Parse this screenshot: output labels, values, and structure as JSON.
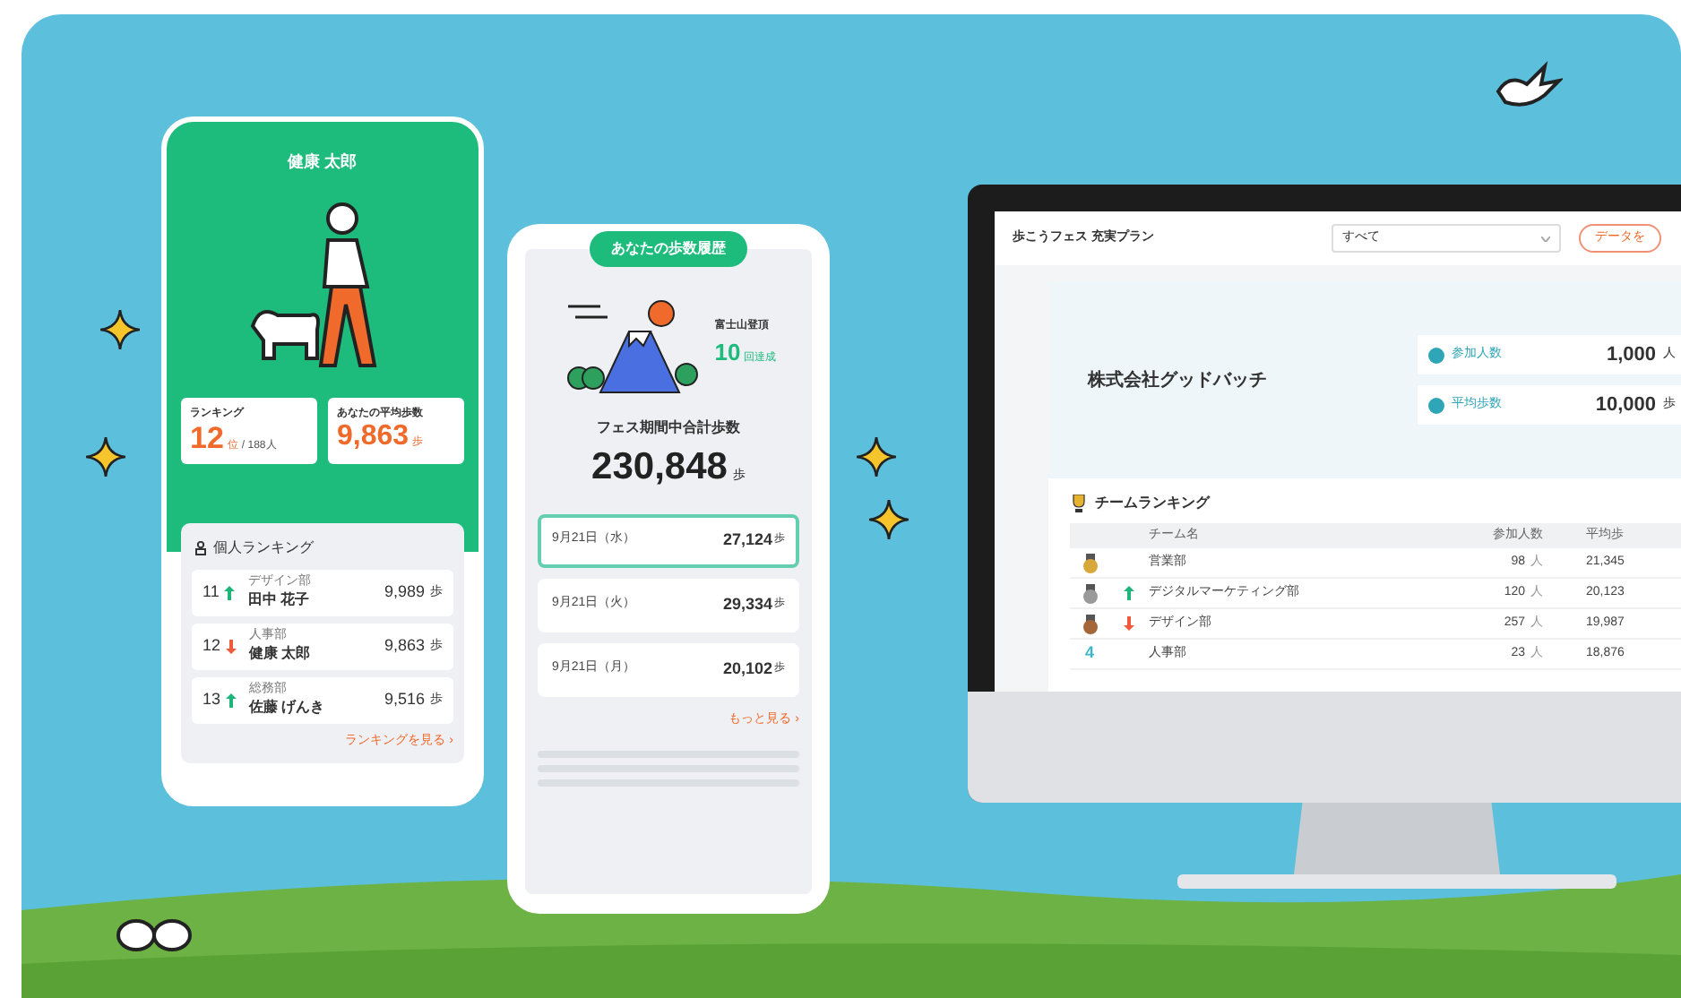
{
  "phone_profile": {
    "user_name": "健康 太郎",
    "ranking": {
      "label": "ランキング",
      "rank": "12",
      "rank_unit": "位",
      "total": "/ 188人"
    },
    "average": {
      "label": "あなたの平均歩数",
      "value": "9,863",
      "unit": "歩"
    },
    "personal_ranking": {
      "title": "個人ランキング",
      "rows": [
        {
          "rank": "11",
          "kind": "up",
          "department": "デザイン部",
          "name": "田中 花子",
          "steps": "9,989",
          "unit": "歩"
        },
        {
          "rank": "12",
          "kind": "down",
          "department": "人事部",
          "name": "健康 太郎",
          "steps": "9,863",
          "unit": "歩"
        },
        {
          "rank": "13",
          "kind": "up",
          "department": "総務部",
          "name": "佐藤 げんき",
          "steps": "9,516",
          "unit": "歩"
        }
      ],
      "link": "ランキングを見る ›"
    }
  },
  "phone_history": {
    "title": "あなたの歩数履歴",
    "badge_label": "富士山登頂",
    "badge_count": "10",
    "badge_unit": "回達成",
    "total_label": "フェス期間中合計歩数",
    "total": "230,848",
    "total_unit": "歩",
    "days": [
      {
        "date": "9月21日（水）",
        "steps": "27,124",
        "unit": "歩",
        "selected": true
      },
      {
        "date": "9月21日（火）",
        "steps": "29,334",
        "unit": "歩",
        "selected": false
      },
      {
        "date": "9月21日（月）",
        "steps": "20,102",
        "unit": "歩",
        "selected": false
      }
    ],
    "more_link": "もっと見る ›"
  },
  "dashboard": {
    "plan_title": "歩こうフェス 充実プラン",
    "filter": {
      "value": "すべて"
    },
    "action_button": "データを",
    "company_name": "株式会社グッドバッチ",
    "stats": [
      {
        "label": "参加人数",
        "value": "1,000",
        "unit": "人"
      },
      {
        "label": "平均歩数",
        "value": "10,000",
        "unit": "歩"
      }
    ],
    "team_ranking": {
      "title": "チームランキング",
      "columns": [
        "チーム名",
        "参加人数",
        "平均歩"
      ],
      "rows": [
        {
          "medal": {
            "kind": "gold"
          },
          "name": "営業部",
          "members": "98",
          "members_unit": "人",
          "average": "21,345"
        },
        {
          "medal": {
            "kind": "silver"
          },
          "trend": {
            "kind": "up"
          },
          "name": "デジタルマーケティング部",
          "members": "120",
          "members_unit": "人",
          "average": "20,123"
        },
        {
          "medal": {
            "kind": "bronze"
          },
          "trend": {
            "kind": "down"
          },
          "name": "デザイン部",
          "members": "257",
          "members_unit": "人",
          "average": "19,987"
        },
        {
          "medal": {
            "kind": "number"
          },
          "rank": "4",
          "name": "人事部",
          "members": "23",
          "members_unit": "人",
          "average": "18,876"
        }
      ]
    }
  }
}
